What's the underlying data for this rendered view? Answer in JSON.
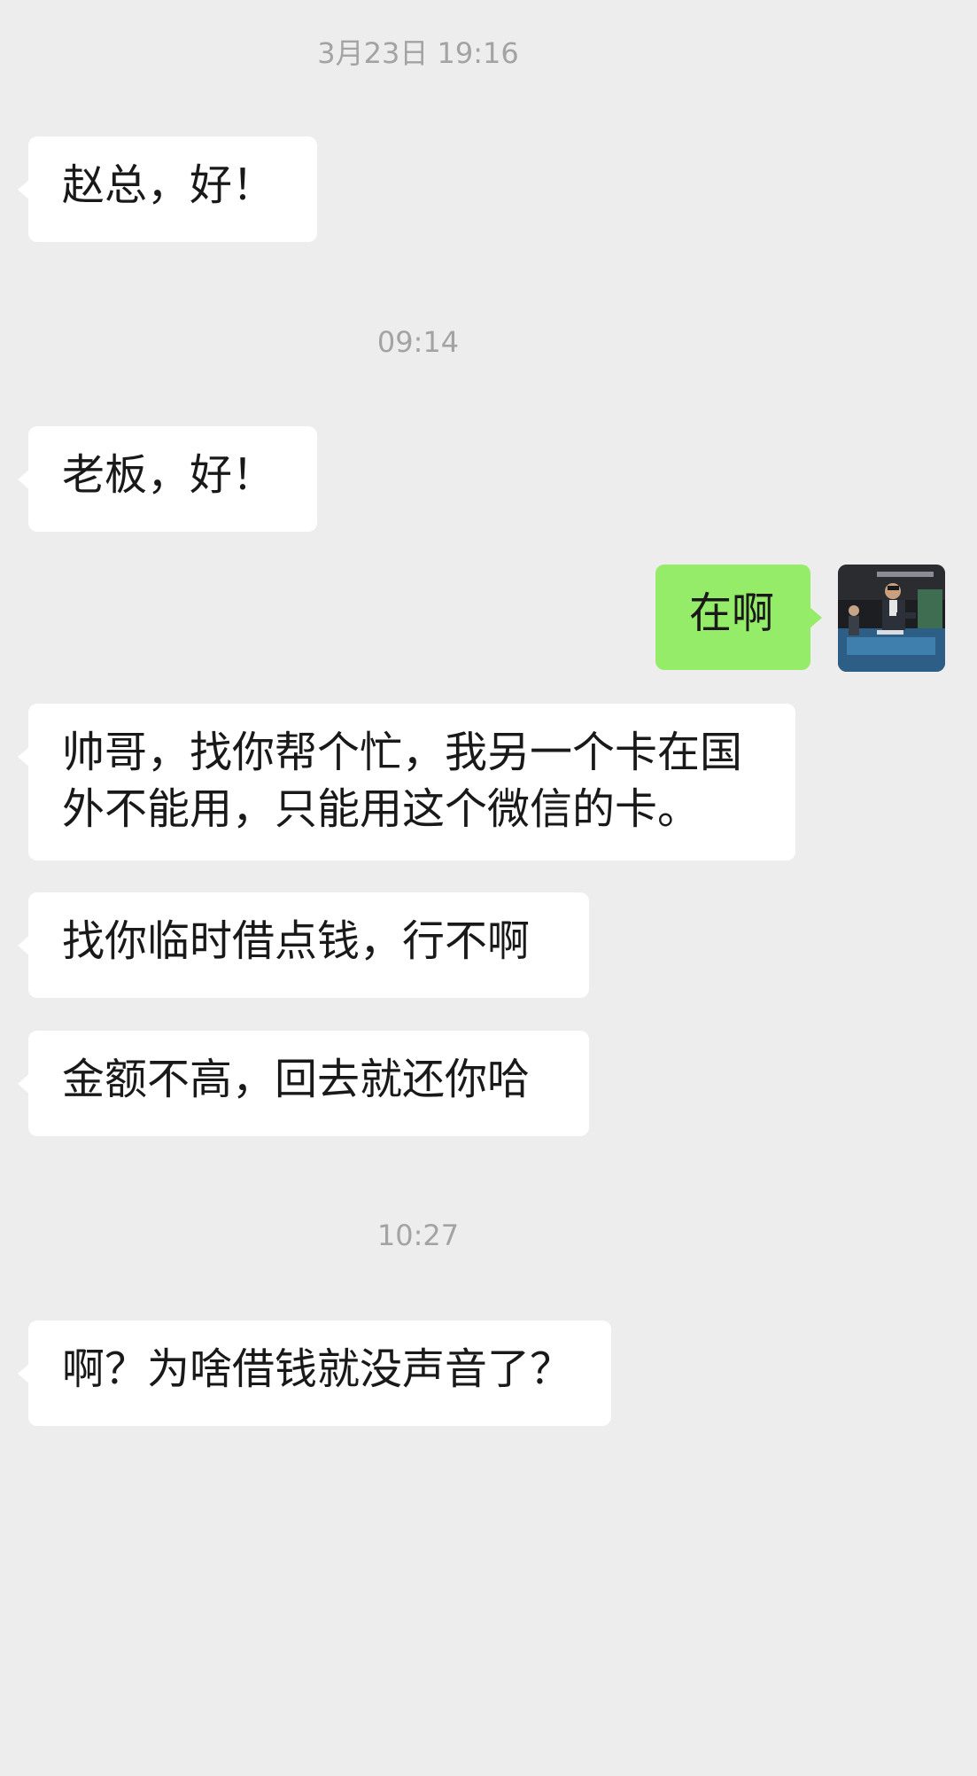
{
  "chat": {
    "timestamps": {
      "t1": "3月23日 19:16",
      "t2": "09:14",
      "t3": "10:27"
    },
    "messages": {
      "m1": "赵总，好！",
      "m2": "老板，好！",
      "m3": "在啊",
      "m4": "帅哥，找你帮个忙，我另一个卡在国\n外不能用，只能用这个微信的卡。",
      "m5": "找你临时借点钱，行不啊",
      "m6": "金额不高，回去就还你哈",
      "m7": "啊？为啥借钱就没声音了？"
    }
  },
  "colors": {
    "background": "#ededed",
    "incoming_bubble": "#ffffff",
    "outgoing_bubble": "#95ec69",
    "timestamp_text": "#a3a3a3"
  },
  "icons": {
    "self_avatar": "avatar-photo-icon"
  }
}
